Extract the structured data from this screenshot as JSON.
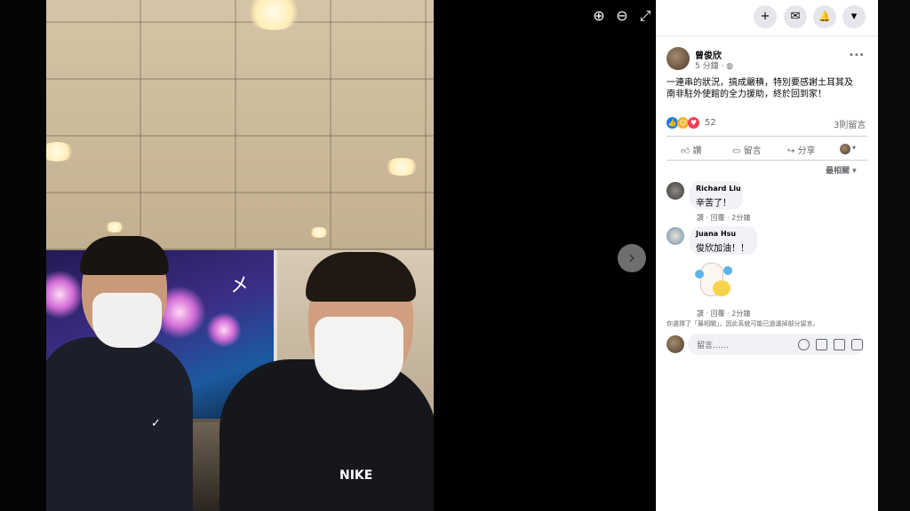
{
  "toolbar": {
    "zoom_in_icon": "⊕",
    "zoom_out_icon": "⊖",
    "fullscreen_icon": "⤢"
  },
  "photo": {
    "next_icon": "›",
    "billboard_logo": "㐅"
  },
  "top_actions": {
    "plus": "+",
    "messenger": "✉",
    "bell": "🔔",
    "dropdown": "▾"
  },
  "post": {
    "author": "曾俊欣",
    "time": "5 分鐘 · ",
    "more_icon": "•••",
    "text_line1": "一連串的狀況，搞成嚴積，特別要感謝土耳其及",
    "text_line2": "南非駐外使館的全力援助，終於回到家！",
    "reaction_count": "52",
    "comment_count": "3則留言",
    "like_label": "讚",
    "comment_label": "留言",
    "share_label": "分享",
    "sort_label": "最相關 ▾"
  },
  "comments": [
    {
      "name": "Richard Liu",
      "text": "辛苦了！",
      "actions": "讚 · 回覆 · 2分鐘"
    },
    {
      "name": "Juana Hsu",
      "text": "俊欣加油！！",
      "actions": "讚 · 回覆 · 2分鐘"
    }
  ],
  "notice": "你選擇了「最相關」，因此系統可能已過濾掉部分留言。",
  "composer": {
    "placeholder": "留言……"
  },
  "colors": {
    "like_blue": "#1877f2",
    "love_red": "#f33e58",
    "care_yellow": "#f7b125"
  }
}
